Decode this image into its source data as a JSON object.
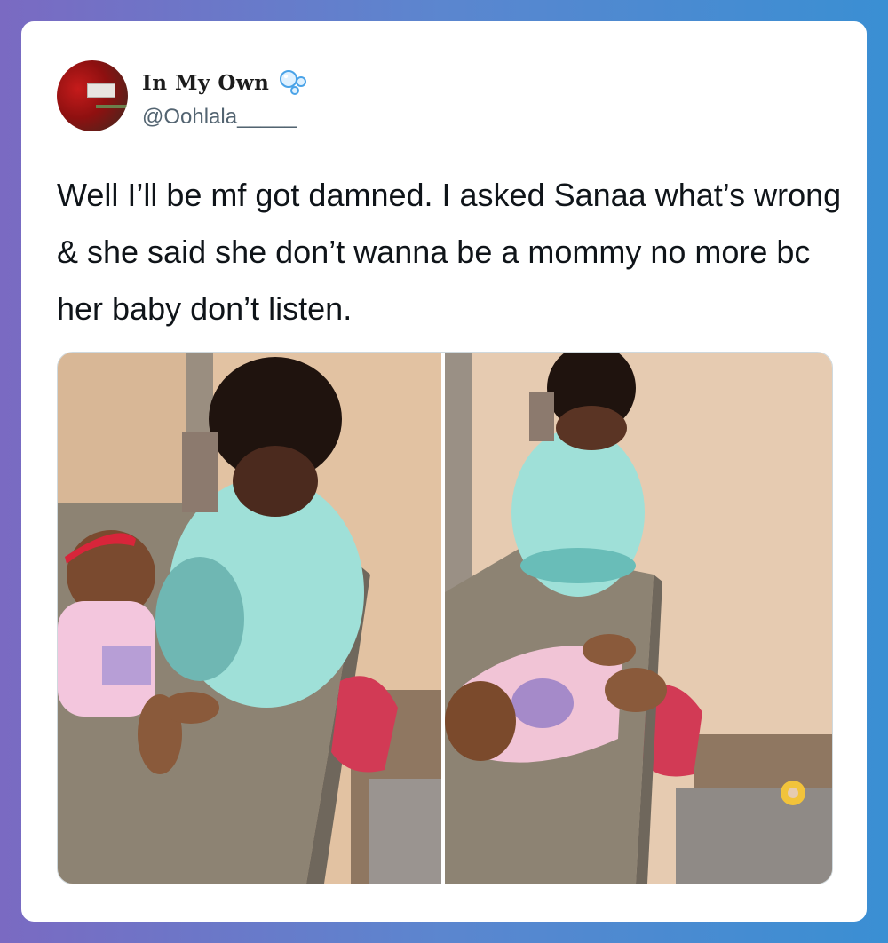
{
  "user": {
    "display_name": "In My Own",
    "handle": "@Oohlala_____",
    "badge_icon": "bubbles-icon",
    "avatar_icon": "avatar-photo"
  },
  "tweet": {
    "text": "Well I’ll be mf got damned. I asked Sanaa what’s wrong & she said she don’t wanna be a mommy no more bc her baby don’t listen."
  },
  "media": {
    "photos": [
      {
        "icon": "photo-child-and-doll-left"
      },
      {
        "icon": "photo-child-and-doll-right"
      }
    ]
  },
  "colors": {
    "background_start": "#7a6ac2",
    "background_end": "#3a8fd3",
    "card": "#ffffff",
    "text": "#0f1419",
    "handle": "#536471"
  }
}
